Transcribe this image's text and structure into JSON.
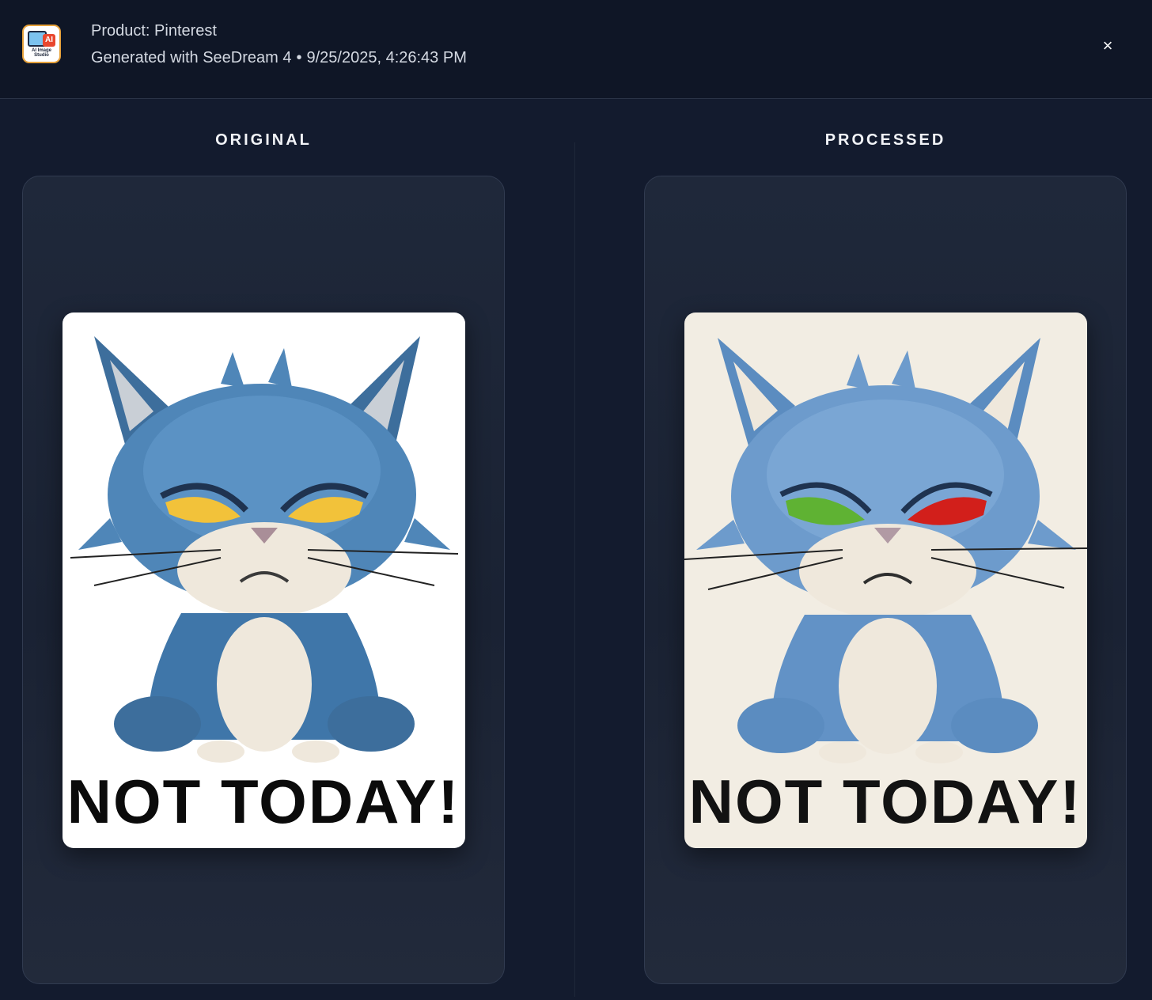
{
  "header": {
    "logo_alt": "AI Image Studio",
    "logo_badge": "AI",
    "logo_caption": "AI Image Studio",
    "product": "Product: Pinterest",
    "model": "Generated with SeeDream 4",
    "separator": "•",
    "timestamp": "9/25/2025, 4:26:43 PM",
    "close_label": "×"
  },
  "panes": {
    "original": {
      "title": "ORIGINAL",
      "image_text": "NOT TODAY!",
      "eye_color_left": "#f2c23a",
      "eye_color_right": "#f2c23a",
      "background": "#ffffff"
    },
    "processed": {
      "title": "PROCESSED",
      "image_text": "NOT TODAY!",
      "eye_color_left": "#5fb233",
      "eye_color_right": "#d21f1b",
      "background": "#f2ede3"
    }
  },
  "colors": {
    "page_bg": "#131b2e",
    "header_bg": "#0f1626",
    "cat_blue": "#4f86b8",
    "cat_white": "#efe8dc"
  }
}
